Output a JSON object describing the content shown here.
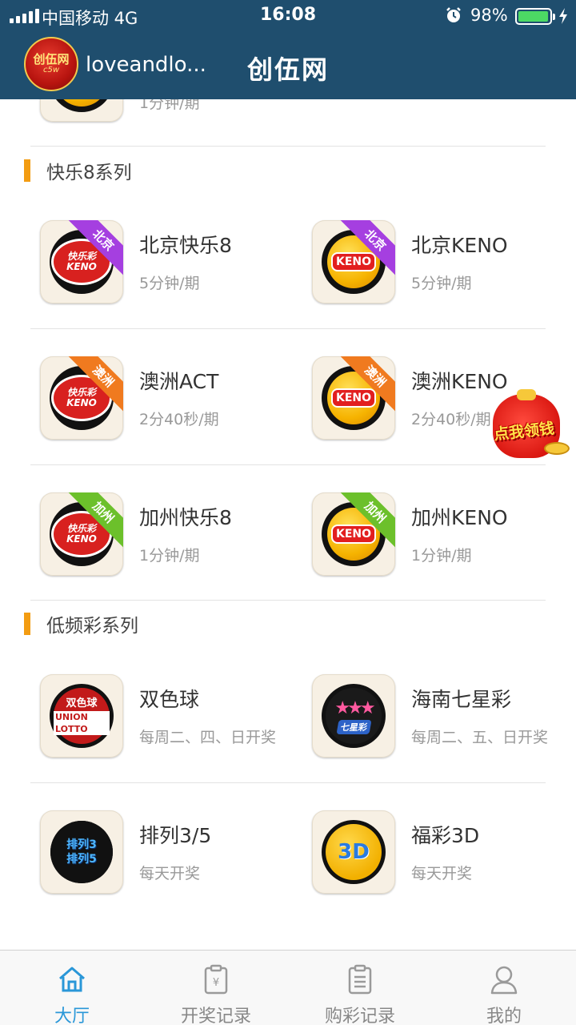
{
  "status_bar": {
    "carrier": "中国移动  4G",
    "time": "16:08",
    "battery_percent": "98%",
    "battery_level": 0.98
  },
  "header": {
    "avatar_text": "创伍网",
    "avatar_sub": "c5w",
    "username": "loveandlo...",
    "title": "创伍网"
  },
  "top_partial_item": {
    "period": "1分钟/期"
  },
  "sections": [
    {
      "title": "快乐8系列",
      "items": [
        {
          "name": "北京快乐8",
          "period": "5分钟/期",
          "badge": "北京",
          "badge_color": "#a53fe0",
          "logo": "kuaile8-keno-logo",
          "logo_text": "快乐彩 KENO"
        },
        {
          "name": "北京KENO",
          "period": "5分钟/期",
          "badge": "北京",
          "badge_color": "#a53fe0",
          "logo": "keno-ball-logo",
          "logo_text": "KENO"
        },
        {
          "name": "澳洲ACT",
          "period": "2分40秒/期",
          "badge": "澳洲",
          "badge_color": "#f07a1f",
          "logo": "kuaile8-keno-logo",
          "logo_text": "快乐彩 KENO"
        },
        {
          "name": "澳洲KENO",
          "period": "2分40秒/期",
          "badge": "澳洲",
          "badge_color": "#f07a1f",
          "logo": "keno-ball-logo",
          "logo_text": "KENO"
        },
        {
          "name": "加州快乐8",
          "period": "1分钟/期",
          "badge": "加州",
          "badge_color": "#6cc02b",
          "logo": "kuaile8-keno-logo",
          "logo_text": "快乐彩 KENO"
        },
        {
          "name": "加州KENO",
          "period": "1分钟/期",
          "badge": "加州",
          "badge_color": "#6cc02b",
          "logo": "keno-ball-logo",
          "logo_text": "KENO"
        }
      ]
    },
    {
      "title": "低频彩系列",
      "items": [
        {
          "name": "双色球",
          "period": "每周二、四、日开奖",
          "logo": "shuangseqiu-logo",
          "logo_text": "双色球",
          "logo_sub": "UNION LOTTO"
        },
        {
          "name": "海南七星彩",
          "period": "每周二、五、日开奖",
          "logo": "qixingcai-logo",
          "logo_text": "七星彩"
        },
        {
          "name": "排列3/5",
          "period": "每天开奖",
          "logo": "pailie35-logo",
          "logo_text": "排列3",
          "logo_sub": "排列5"
        },
        {
          "name": "福彩3D",
          "period": "每天开奖",
          "logo": "fucai3d-logo",
          "logo_text": "3D"
        }
      ]
    }
  ],
  "promo": {
    "label": "点我领钱"
  },
  "tabbar": [
    {
      "label": "大厅",
      "icon": "home-icon",
      "active": true
    },
    {
      "label": "开奖记录",
      "icon": "yen-clipboard-icon",
      "active": false
    },
    {
      "label": "购彩记录",
      "icon": "clipboard-list-icon",
      "active": false
    },
    {
      "label": "我的",
      "icon": "user-icon",
      "active": false
    }
  ],
  "colors": {
    "header_bg": "#1f4e6e",
    "accent": "#2a97d8",
    "section_bar": "#f39c12"
  }
}
